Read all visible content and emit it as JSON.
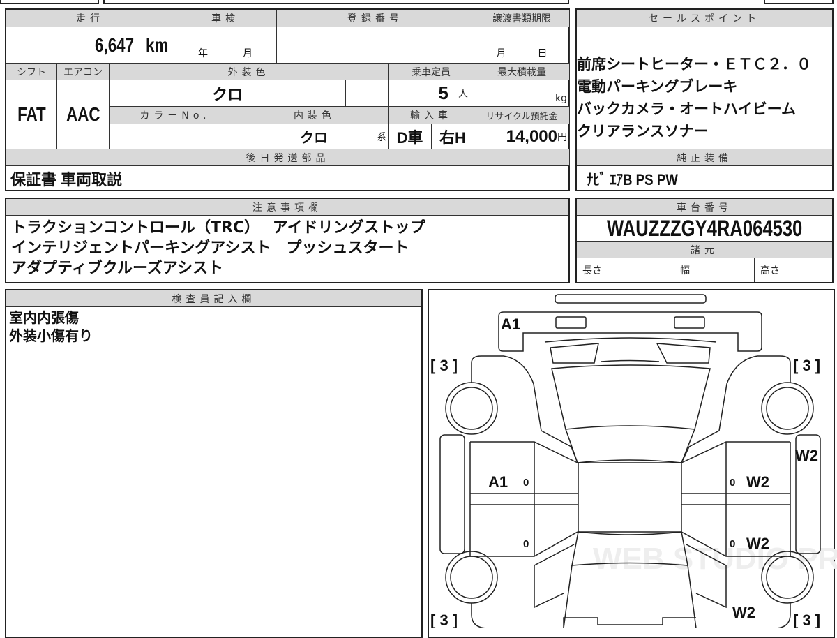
{
  "main": {
    "mileage_label": "走行",
    "mileage": "6,647",
    "mileage_unit": "km",
    "inspection_label": "車検",
    "inspection_year": "年",
    "inspection_month": "月",
    "registration_label": "登録番号",
    "transfer_deadline_label": "譲渡書類期限",
    "transfer_month": "月",
    "transfer_day": "日",
    "shift_label": "シフト",
    "shift": "FAT",
    "aircon_label": "エアコン",
    "aircon": "AAC",
    "exterior_color_label": "外装色",
    "exterior_color": "クロ",
    "capacity_label": "乗車定員",
    "capacity": "5",
    "capacity_unit": "人",
    "max_load_label": "最大積載量",
    "max_load_unit": "kg",
    "color_no_label": "カラーNo.",
    "interior_color_label": "内装色",
    "interior_color": "クロ",
    "interior_suffix": "系",
    "import_label": "輸入車",
    "import_type": "D車",
    "steering": "右H",
    "recycle_label": "リサイクル預託金",
    "recycle_fee": "14,000",
    "recycle_unit": "円",
    "later_parts_label": "後日発送部品",
    "later_parts": "保証書 車両取説"
  },
  "sales_points": {
    "label": "セールスポイント",
    "lines": [
      "前席シートヒーター・ＥＴＣ２．０",
      "電動パーキングブレーキ",
      "バックカメラ・オートハイビーム",
      "クリアランスソナー"
    ]
  },
  "equipment": {
    "label": "純正装備",
    "value": "ﾅﾋﾞ ｴｱB PS PW"
  },
  "notes": {
    "label": "注意事項欄",
    "lines": [
      "トラクションコントロール（TRC）　 アイドリングストップ",
      "インテリジェントパーキングアシスト　プッシュスタート",
      "アダプティブクルーズアシスト"
    ]
  },
  "chassis": {
    "label": "車台番号",
    "vin": "WAUZZZGY4RA064530",
    "specs_label": "諸元",
    "length_label": "長さ",
    "width_label": "幅",
    "height_label": "高さ"
  },
  "inspector": {
    "label": "検査員記入欄",
    "lines": [
      "室内内張傷",
      "外装小傷有り"
    ]
  },
  "diagram": {
    "front_bumper": "A1",
    "left_mark": "A1",
    "zero": "0",
    "w2": "W2",
    "tire": "[ 3 ]",
    "watermark": "WEB STUDIO PRO"
  }
}
